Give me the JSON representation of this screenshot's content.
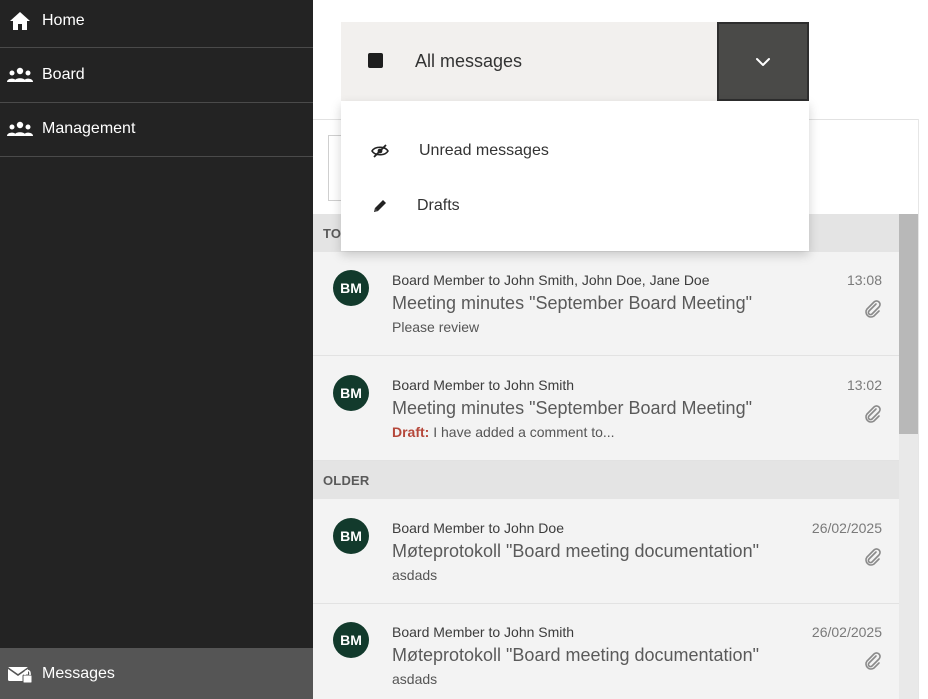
{
  "sidebar": {
    "items": [
      {
        "label": "Home",
        "icon": "home-icon"
      },
      {
        "label": "Board",
        "icon": "group-icon"
      },
      {
        "label": "Management",
        "icon": "group-icon"
      }
    ],
    "bottom_item": {
      "label": "Messages",
      "icon": "mail-lock-icon"
    }
  },
  "filter": {
    "selected_label": "All messages",
    "options": [
      {
        "label": "Unread messages",
        "icon": "eye-slash-icon"
      },
      {
        "label": "Drafts",
        "icon": "pencil-icon"
      }
    ]
  },
  "groups": {
    "today_label": "TO",
    "older_label": "OLDER"
  },
  "messages": [
    {
      "initials": "BM",
      "from": "Board Member to John Smith, John Doe, Jane Doe",
      "subject": "Meeting minutes \"September Board Meeting\"",
      "draft_label": "",
      "preview": "Please review",
      "time": "13:08"
    },
    {
      "initials": "BM",
      "from": "Board Member to John Smith",
      "subject": "Meeting minutes \"September Board Meeting\"",
      "draft_label": "Draft:",
      "preview": " I have added a comment to...",
      "time": "13:02"
    },
    {
      "initials": "BM",
      "from": "Board Member to John Doe",
      "subject": "Møteprotokoll \"Board meeting documentation\"",
      "draft_label": "",
      "preview": "asdads",
      "time": "26/02/2025"
    },
    {
      "initials": "BM",
      "from": "Board Member to John Smith",
      "subject": "Møteprotokoll \"Board meeting documentation\"",
      "draft_label": "",
      "preview": "asdads",
      "time": "26/02/2025"
    }
  ],
  "colors": {
    "sidebar_bg": "#232323",
    "avatar_bg": "#123a2c",
    "draft_red": "#b5473a",
    "toggle_bg": "#4a4a48"
  }
}
